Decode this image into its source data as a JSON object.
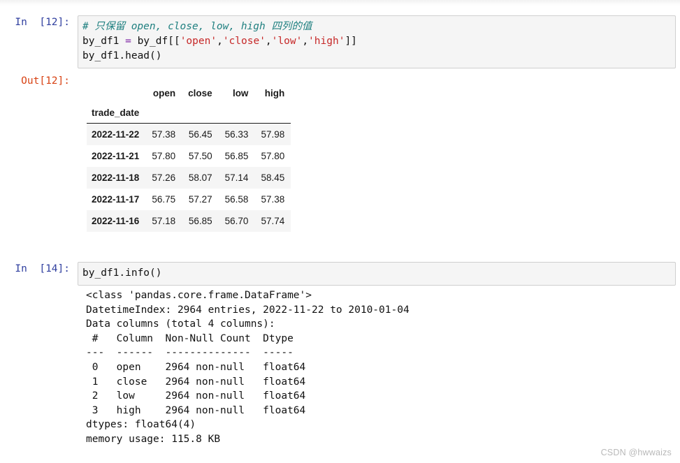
{
  "notebook": {
    "cells": [
      {
        "prompt": "In  [12]:",
        "code_lines": [
          {
            "segments": [
              {
                "kind": "comment",
                "text": "# 只保留 open, close, low, high 四列的值"
              }
            ]
          },
          {
            "segments": [
              {
                "kind": "plain",
                "text": "by_df1 "
              },
              {
                "kind": "op",
                "text": "="
              },
              {
                "kind": "plain",
                "text": " by_df[["
              },
              {
                "kind": "str",
                "text": "'open'"
              },
              {
                "kind": "plain",
                "text": ","
              },
              {
                "kind": "str",
                "text": "'close'"
              },
              {
                "kind": "plain",
                "text": ","
              },
              {
                "kind": "str",
                "text": "'low'"
              },
              {
                "kind": "plain",
                "text": ","
              },
              {
                "kind": "str",
                "text": "'high'"
              },
              {
                "kind": "plain",
                "text": "]]"
              }
            ]
          },
          {
            "segments": [
              {
                "kind": "plain",
                "text": "by_df1.head()"
              }
            ]
          }
        ]
      },
      {
        "prompt": "In  [14]:",
        "code_lines": [
          {
            "segments": [
              {
                "kind": "plain",
                "text": "by_df1.info()"
              }
            ]
          }
        ]
      }
    ],
    "output_prompt": "Out[12]:",
    "dataframe": {
      "index_name": "trade_date",
      "columns": [
        "open",
        "close",
        "low",
        "high"
      ],
      "rows": [
        {
          "index": "2022-11-22",
          "values": [
            "57.38",
            "56.45",
            "56.33",
            "57.98"
          ]
        },
        {
          "index": "2022-11-21",
          "values": [
            "57.80",
            "57.50",
            "56.85",
            "57.80"
          ]
        },
        {
          "index": "2022-11-18",
          "values": [
            "57.26",
            "58.07",
            "57.14",
            "58.45"
          ]
        },
        {
          "index": "2022-11-17",
          "values": [
            "56.75",
            "57.27",
            "56.58",
            "57.38"
          ]
        },
        {
          "index": "2022-11-16",
          "values": [
            "57.18",
            "56.85",
            "56.70",
            "57.74"
          ]
        }
      ]
    },
    "info_output": "<class 'pandas.core.frame.DataFrame'>\nDatetimeIndex: 2964 entries, 2022-11-22 to 2010-01-04\nData columns (total 4 columns):\n #   Column  Non-Null Count  Dtype\n---  ------  --------------  -----\n 0   open    2964 non-null   float64\n 1   close   2964 non-null   float64\n 2   low     2964 non-null   float64\n 3   high    2964 non-null   float64\ndtypes: float64(4)\nmemory usage: 115.8 KB"
  },
  "watermark": "CSDN @hwwaizs",
  "colors": {
    "prompt_in": "#303f9f",
    "prompt_out": "#d84315",
    "code_bg": "#f5f5f5",
    "code_border": "#cfcfcf",
    "comment": "#208080",
    "string": "#c62828",
    "operator": "#7b1fa2",
    "row_stripe": "#f5f5f5",
    "watermark": "#b9b9b9"
  }
}
